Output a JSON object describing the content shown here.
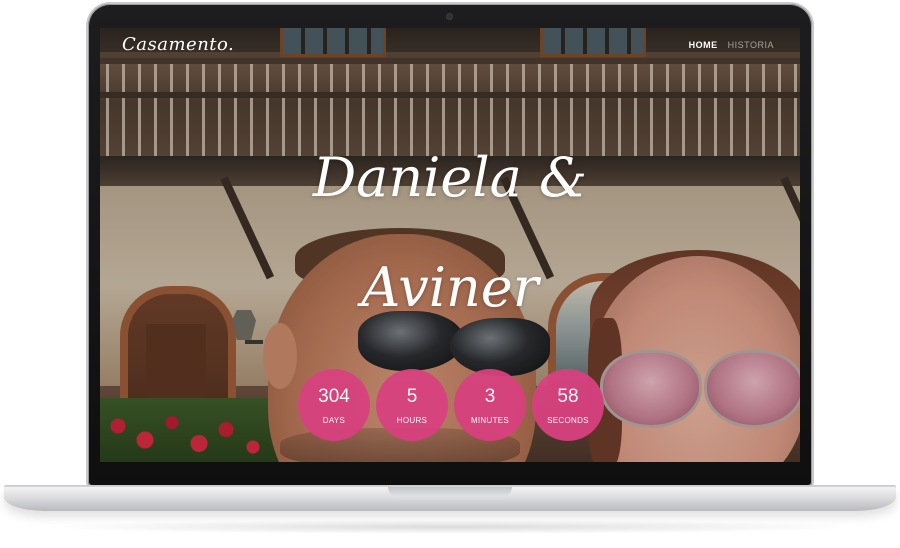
{
  "site": {
    "logo": "Casamento.",
    "nav": [
      {
        "label": "HOME"
      },
      {
        "label": "HISTORIA"
      }
    ],
    "couple": {
      "line1": "Daniela &",
      "line2": "Aviner"
    },
    "countdown": [
      {
        "value": "304",
        "label": "DAYS"
      },
      {
        "value": "5",
        "label": "HOURS"
      },
      {
        "value": "3",
        "label": "MINUTES"
      },
      {
        "value": "58",
        "label": "SECONDS"
      }
    ]
  },
  "colors": {
    "accent": "#d8417f",
    "laptop_bezel": "#111112",
    "laptop_body": "#dcdcdf"
  }
}
